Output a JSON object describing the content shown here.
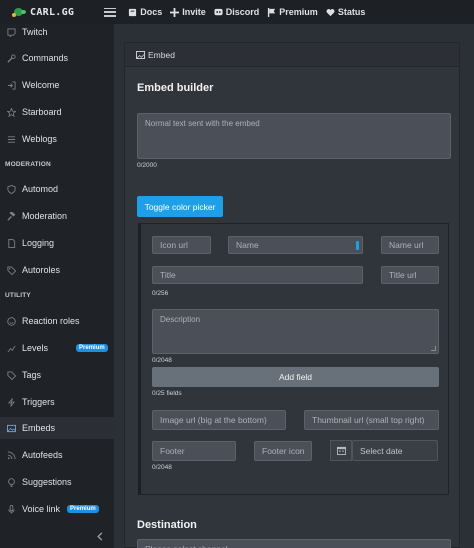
{
  "brand": {
    "name": "CARL.GG"
  },
  "topnav": [
    {
      "label": "Docs",
      "icon": "book-icon"
    },
    {
      "label": "Invite",
      "icon": "plus-icon"
    },
    {
      "label": "Discord",
      "icon": "discord-icon"
    },
    {
      "label": "Premium",
      "icon": "flag-icon"
    },
    {
      "label": "Status",
      "icon": "heartbeat-icon"
    }
  ],
  "sidebar": {
    "sections": {
      "moderation": "MODERATION",
      "utility": "UTILITY"
    },
    "items": [
      {
        "label": "Twitch",
        "icon": "twitch-icon"
      },
      {
        "label": "Commands",
        "icon": "wrench-icon"
      },
      {
        "label": "Welcome",
        "icon": "sign-in-icon"
      },
      {
        "label": "Starboard",
        "icon": "star-icon"
      },
      {
        "label": "Weblogs",
        "icon": "list-icon"
      },
      {
        "label": "Automod",
        "icon": "shield-icon"
      },
      {
        "label": "Moderation",
        "icon": "hammer-icon"
      },
      {
        "label": "Logging",
        "icon": "file-icon"
      },
      {
        "label": "Autoroles",
        "icon": "tag-icon"
      },
      {
        "label": "Reaction roles",
        "icon": "smile-icon"
      },
      {
        "label": "Levels",
        "icon": "chart-icon",
        "badge": "Premium"
      },
      {
        "label": "Tags",
        "icon": "tags-icon"
      },
      {
        "label": "Triggers",
        "icon": "bolt-icon"
      },
      {
        "label": "Embeds",
        "icon": "image-icon"
      },
      {
        "label": "Autofeeds",
        "icon": "rss-icon"
      },
      {
        "label": "Suggestions",
        "icon": "lightbulb-icon"
      },
      {
        "label": "Voice link",
        "icon": "microphone-icon",
        "badge": "Premium"
      }
    ],
    "collapse_icon": "chevron-left-icon"
  },
  "card": {
    "header": "Embed",
    "title": "Embed builder",
    "content_placeholder": "Normal text sent with the embed",
    "content_counter": "0/2000",
    "color_button": "Toggle color picker",
    "fields": {
      "icon_url": "Icon url",
      "name": "Name",
      "name_url": "Name url",
      "title": "Title",
      "title_url": "Title url",
      "title_counter": "0/256",
      "description": "Description",
      "description_counter": "0/2048",
      "add_field": "Add field",
      "fields_counter": "0/25 fields",
      "image_url": "Image url (big at the bottom)",
      "thumbnail_url": "Thumbnail url (small top right)",
      "footer": "Footer",
      "footer_icon": "Footer icon",
      "date": "Select date",
      "footer_counter": "0/2048"
    },
    "destination_title": "Destination",
    "destination_placeholder": "Please select channel"
  },
  "colors": {
    "accent": "#1ea0e8",
    "premium": "#1e8ee0",
    "sidebar": "#1f2227",
    "topbar": "#1d2025"
  }
}
